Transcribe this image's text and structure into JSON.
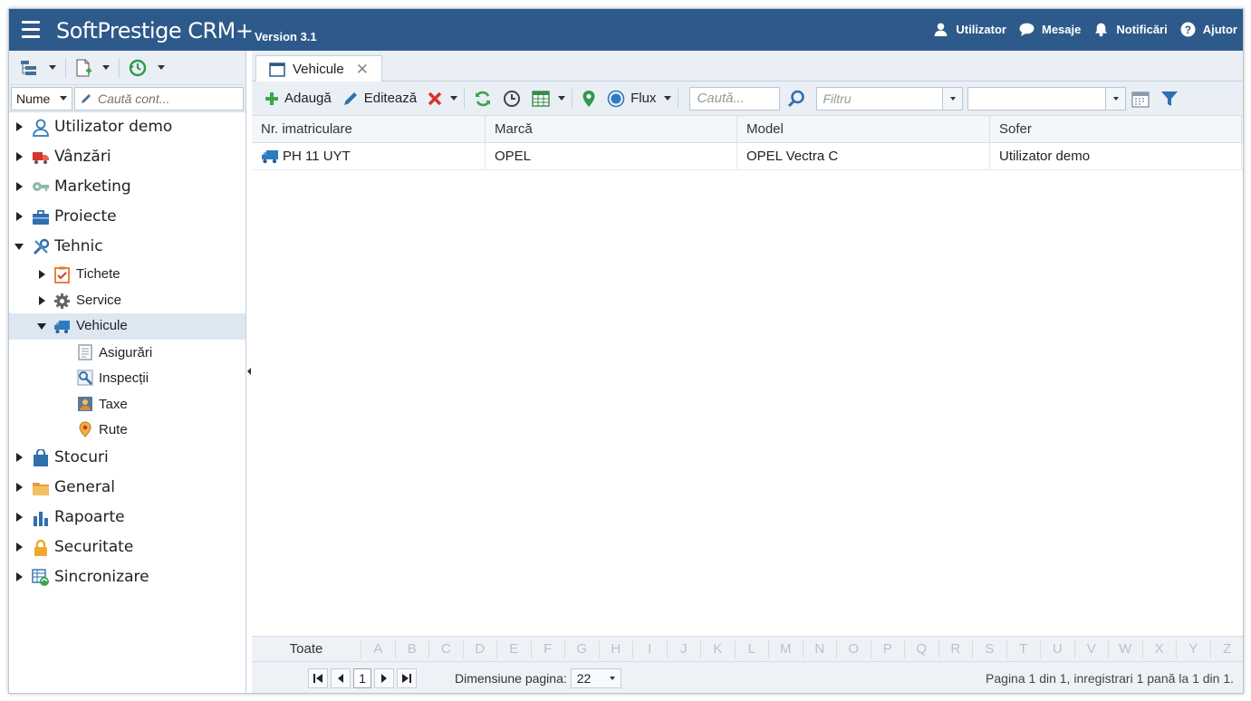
{
  "header": {
    "app_title": "SoftPrestige CRM+",
    "version": "Version 3.1",
    "links": [
      {
        "label": "Utilizator",
        "icon": "user-icon"
      },
      {
        "label": "Mesaje",
        "icon": "chat-icon"
      },
      {
        "label": "Notificări",
        "icon": "bell-icon"
      },
      {
        "label": "Ajutor",
        "icon": "help-icon"
      }
    ]
  },
  "sidebar": {
    "search": {
      "field_label": "Nume",
      "placeholder": "Caută cont..."
    },
    "tree": [
      {
        "label": "Utilizator demo",
        "icon": "user-outline-icon",
        "expanded": false
      },
      {
        "label": "Vânzări",
        "icon": "truck-sales-icon",
        "expanded": false
      },
      {
        "label": "Marketing",
        "icon": "key-icon",
        "expanded": false
      },
      {
        "label": "Proiecte",
        "icon": "briefcase-icon",
        "expanded": false
      },
      {
        "label": "Tehnic",
        "icon": "tools-icon",
        "expanded": true,
        "children": [
          {
            "label": "Tichete",
            "icon": "clipboard-check-icon",
            "expanded": false
          },
          {
            "label": "Service",
            "icon": "gear-icon",
            "expanded": false
          },
          {
            "label": "Vehicule",
            "icon": "truck-icon",
            "expanded": true,
            "selected": true,
            "children": [
              {
                "label": "Asigurări",
                "icon": "document-icon"
              },
              {
                "label": "Inspecții",
                "icon": "wrench-icon"
              },
              {
                "label": "Taxe",
                "icon": "tax-icon"
              },
              {
                "label": "Rute",
                "icon": "map-pin-icon"
              }
            ]
          }
        ]
      },
      {
        "label": "Stocuri",
        "icon": "shopping-bag-icon",
        "expanded": false
      },
      {
        "label": "General",
        "icon": "folder-icon",
        "expanded": false
      },
      {
        "label": "Rapoarte",
        "icon": "bar-chart-icon",
        "expanded": false
      },
      {
        "label": "Securitate",
        "icon": "lock-icon",
        "expanded": false
      },
      {
        "label": "Sincronizare",
        "icon": "sync-table-icon",
        "expanded": false
      }
    ]
  },
  "main": {
    "tab": {
      "label": "Vehicule",
      "close": "✕"
    },
    "toolbar": {
      "add_label": "Adaugă",
      "edit_label": "Editează",
      "flux_label": "Flux",
      "search_placeholder": "Caută...",
      "filter_placeholder": "Filtru",
      "filter2_value": ""
    },
    "grid": {
      "columns": [
        "Nr. imatriculare",
        "Marcă",
        "Model",
        "Sofer"
      ],
      "rows": [
        [
          "PH 11 UYT",
          "OPEL",
          "OPEL Vectra C",
          "Utilizator demo"
        ]
      ]
    },
    "alpha": {
      "all_label": "Toate",
      "letters": [
        "A",
        "B",
        "C",
        "D",
        "E",
        "F",
        "G",
        "H",
        "I",
        "J",
        "K",
        "L",
        "M",
        "N",
        "O",
        "P",
        "Q",
        "R",
        "S",
        "T",
        "U",
        "V",
        "W",
        "X",
        "Y",
        "Z"
      ]
    },
    "pager": {
      "current_page": "1",
      "size_label": "Dimensiune pagina:",
      "size_value": "22",
      "info": "Pagina 1 din 1, inregistrari 1 pană la 1 din 1."
    }
  },
  "colors": {
    "header_bg": "#2d5a8a",
    "toolbar_bg": "#e9eff5",
    "selected_bg": "#dde7f1",
    "accent_blue": "#2f7bbf",
    "add_green": "#3aa64a",
    "delete_red": "#d9342b"
  }
}
